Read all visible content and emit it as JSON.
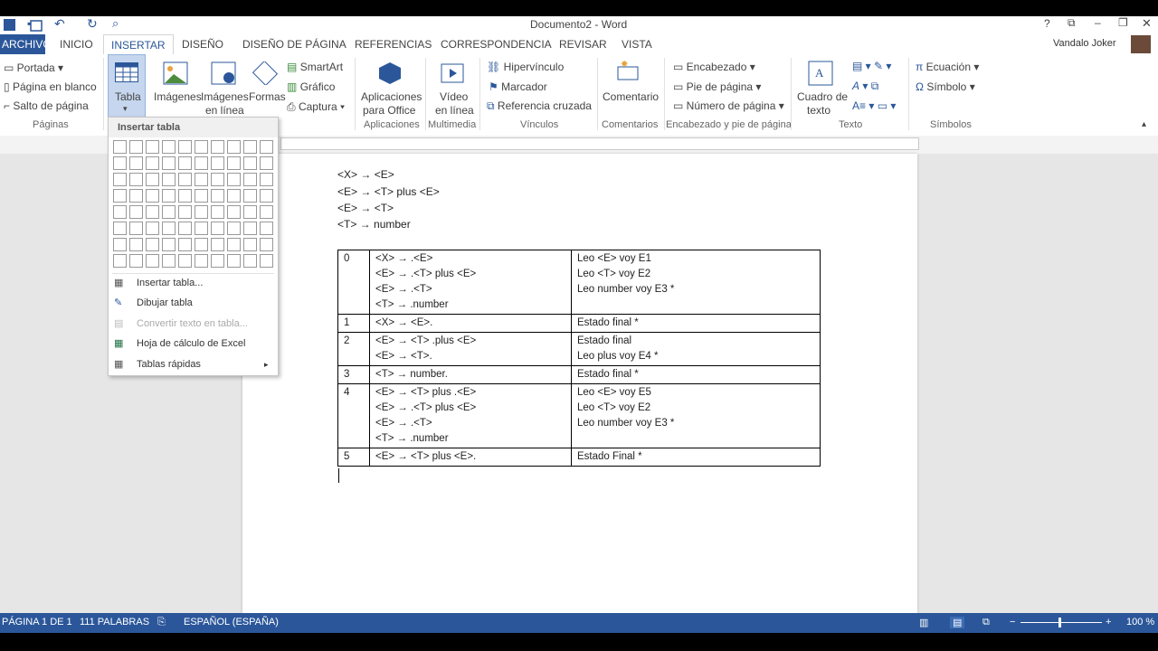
{
  "window": {
    "title": "Documento2 - Word",
    "user": "Vandalo Joker"
  },
  "tabs": [
    "ARCHIVO",
    "INICIO",
    "INSERTAR",
    "DISEÑO",
    "DISEÑO DE PÁGINA",
    "REFERENCIAS",
    "CORRESPONDENCIA",
    "REVISAR",
    "VISTA"
  ],
  "ribbon": {
    "paginas": {
      "portada": "Portada",
      "pagina_en_blanco": "Página en blanco",
      "salto": "Salto de página",
      "label": "Páginas"
    },
    "tabla": {
      "label": "Tabla"
    },
    "ilustraciones": {
      "imagenes": "Imágenes",
      "imagenes_linea_1": "Imágenes",
      "imagenes_linea_2": "en línea",
      "formas": "Formas",
      "smartart": "SmartArt",
      "grafico": "Gráfico",
      "captura": "Captura"
    },
    "aplicaciones": {
      "btn_1": "Aplicaciones",
      "btn_2": "para Office",
      "label": "Aplicaciones"
    },
    "multimedia": {
      "btn_1": "Vídeo",
      "btn_2": "en línea",
      "label": "Multimedia"
    },
    "vinculos": {
      "hipervinculo": "Hipervínculo",
      "marcador": "Marcador",
      "referencia": "Referencia cruzada",
      "label": "Vínculos"
    },
    "comentarios": {
      "btn": "Comentario",
      "label": "Comentarios"
    },
    "encabezado": {
      "encabezado": "Encabezado",
      "pie": "Pie de página",
      "numero": "Número de página",
      "label": "Encabezado y pie de página"
    },
    "texto": {
      "cuadro_1": "Cuadro de",
      "cuadro_2": "texto",
      "label": "Texto"
    },
    "simbolos": {
      "ecuacion": "Ecuación",
      "simbolo": "Símbolo",
      "label": "Símbolos"
    }
  },
  "menu": {
    "header": "Insertar tabla",
    "items": [
      "Insertar tabla...",
      "Dibujar tabla",
      "Convertir texto en tabla...",
      "Hoja de cálculo de Excel",
      "Tablas rápidas"
    ]
  },
  "document": {
    "lines": [
      "<X> → <E>",
      "<E> → <T> plus <E>",
      "<E> → <T>",
      "<T> → number"
    ],
    "table": [
      {
        "state": "0",
        "items": [
          "<X> → .<E>",
          "<E> → .<T> plus <E>",
          "<E> → .<T>",
          "<T> → .number"
        ],
        "actions": [
          "Leo <E> voy E1",
          "Leo <T> voy E2",
          "Leo number voy E3  *"
        ]
      },
      {
        "state": "1",
        "items": [
          "<X> → <E>."
        ],
        "actions": [
          "Estado final *"
        ]
      },
      {
        "state": "2",
        "items": [
          "<E> → <T> .plus <E>",
          "<E> → <T>."
        ],
        "actions": [
          "Estado final",
          "Leo plus voy E4 *"
        ]
      },
      {
        "state": "3",
        "items": [
          "<T> → number."
        ],
        "actions": [
          "Estado final *"
        ]
      },
      {
        "state": "4",
        "items": [
          "<E> → <T> plus .<E>",
          "<E> → .<T> plus <E>",
          "<E> → .<T>",
          "<T> → .number"
        ],
        "actions": [
          "Leo <E> voy E5",
          "Leo <T> voy E2",
          "Leo number voy E3 *"
        ]
      },
      {
        "state": "5",
        "items": [
          "<E> → <T> plus <E>."
        ],
        "actions": [
          "Estado Final *"
        ]
      }
    ]
  },
  "status": {
    "page": "PÁGINA 1 DE 1",
    "words": "111 PALABRAS",
    "language": "ESPAÑOL (ESPAÑA)",
    "zoom": "100 %"
  },
  "colors": {
    "accent": "#2b579a"
  }
}
